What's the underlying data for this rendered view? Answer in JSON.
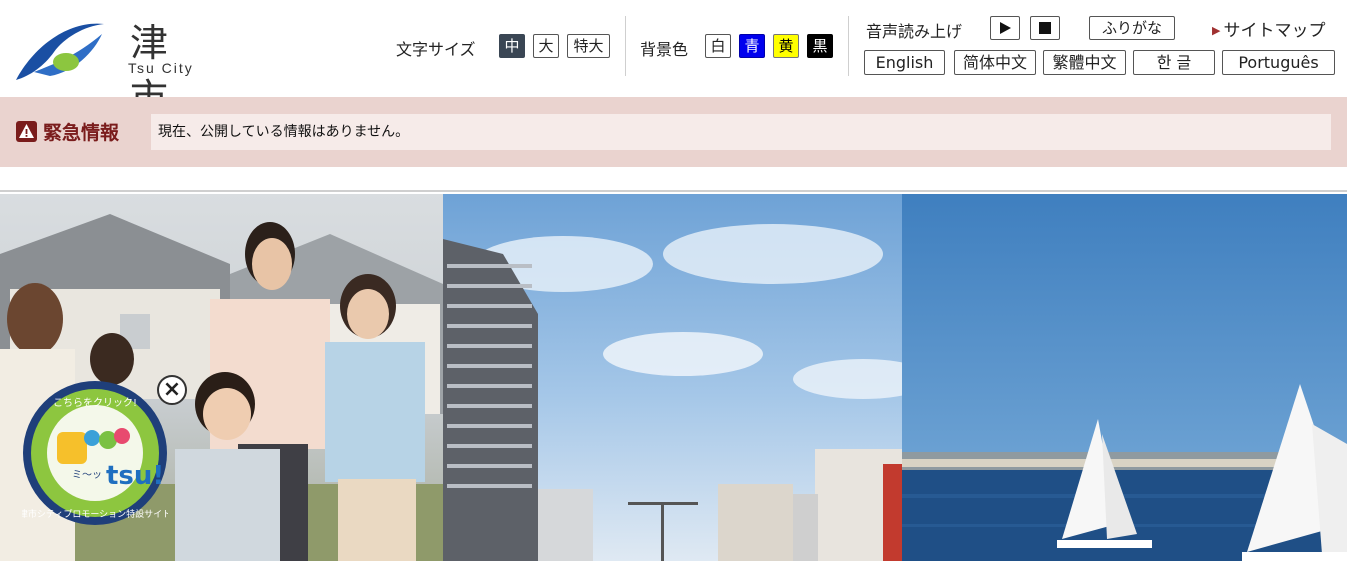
{
  "header": {
    "logo": {
      "kanji": "津 市",
      "roman": "Tsu City"
    },
    "font_size": {
      "label": "文字サイズ",
      "options": [
        "中",
        "大",
        "特大"
      ],
      "selected": "中"
    },
    "bg_color": {
      "label": "背景色",
      "options": [
        "白",
        "青",
        "黄",
        "黒"
      ],
      "colors": [
        "#ffffff",
        "#0000ee",
        "#ffff00",
        "#000000"
      ]
    },
    "speech": {
      "label": "音声読み上げ",
      "play_icon": "play-icon",
      "stop_icon": "stop-icon"
    },
    "furigana": "ふりがな",
    "sitemap": "サイトマップ",
    "languages": [
      "English",
      "简体中文",
      "繁體中文",
      "한 글",
      "Português"
    ]
  },
  "emergency": {
    "title": "緊急情報",
    "icon": "warning-icon",
    "message": "現在、公開している情報はありません。",
    "bar_color": "#ead3cf",
    "accent_color": "#7a1c1c"
  },
  "hero": {
    "panels": [
      "family-photo",
      "city-street-photo",
      "sailboats-photo"
    ],
    "badge": {
      "top_text": "こちらをクリック!",
      "title_text": "ミ〜ッ tsu!",
      "bottom_text": "津市シティプロモーション特設サイト",
      "close_icon": "close-icon"
    }
  }
}
